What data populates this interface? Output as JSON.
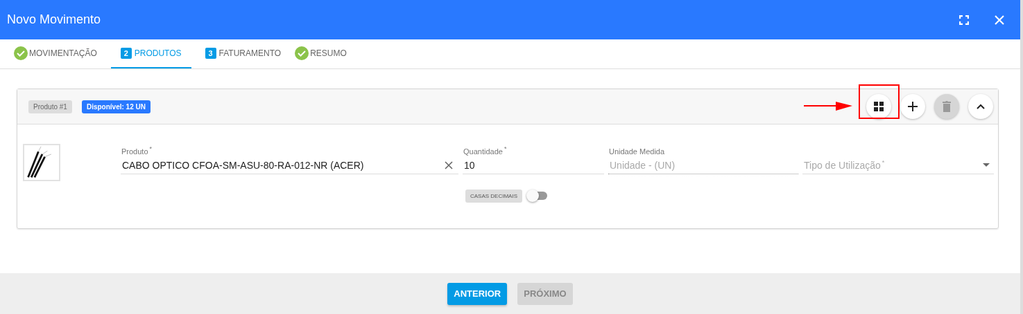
{
  "window": {
    "title": "Novo Movimento"
  },
  "tabs": [
    {
      "label": "MOVIMENTAÇÃO",
      "kind": "done",
      "selected": false
    },
    {
      "label": "PRODUTOS",
      "kind": "step",
      "number": "2",
      "selected": true
    },
    {
      "label": "FATURAMENTO",
      "kind": "step",
      "number": "3",
      "selected": false
    },
    {
      "label": "RESUMO",
      "kind": "done",
      "selected": false
    }
  ],
  "product_card": {
    "tag": "Produto #1",
    "stock_badge": "Disponível: 12 UN",
    "actions": [
      {
        "kind": "grid",
        "disabled": false,
        "highlighted": true
      },
      {
        "kind": "add",
        "disabled": false,
        "highlighted": false
      },
      {
        "kind": "delete",
        "disabled": true,
        "highlighted": false
      },
      {
        "kind": "collapse",
        "disabled": false,
        "highlighted": false
      }
    ],
    "fields": [
      {
        "label": "Produto",
        "required_mark": "*",
        "value": "CABO OPTICO CFOA-SM-ASU-80-RA-012-NR (ACER)",
        "kind": "clearable",
        "disabled": false
      },
      {
        "label": "Quantidade",
        "required_mark": "*",
        "value": "10",
        "kind": "text",
        "disabled": false
      },
      {
        "label": "Unidade Medida",
        "placeholder": "Unidade - (UN)",
        "kind": "text",
        "disabled": true
      },
      {
        "placeholder": "Tipo de Utilização",
        "required_mark": "*",
        "kind": "select",
        "disabled": false
      }
    ],
    "decimal_toggle": {
      "label": "CASAS DECIMAIS",
      "on": false
    }
  },
  "footer": {
    "buttons": [
      {
        "label": "ANTERIOR",
        "disabled": false
      },
      {
        "label": "PRÓXIMO",
        "disabled": true
      }
    ]
  }
}
